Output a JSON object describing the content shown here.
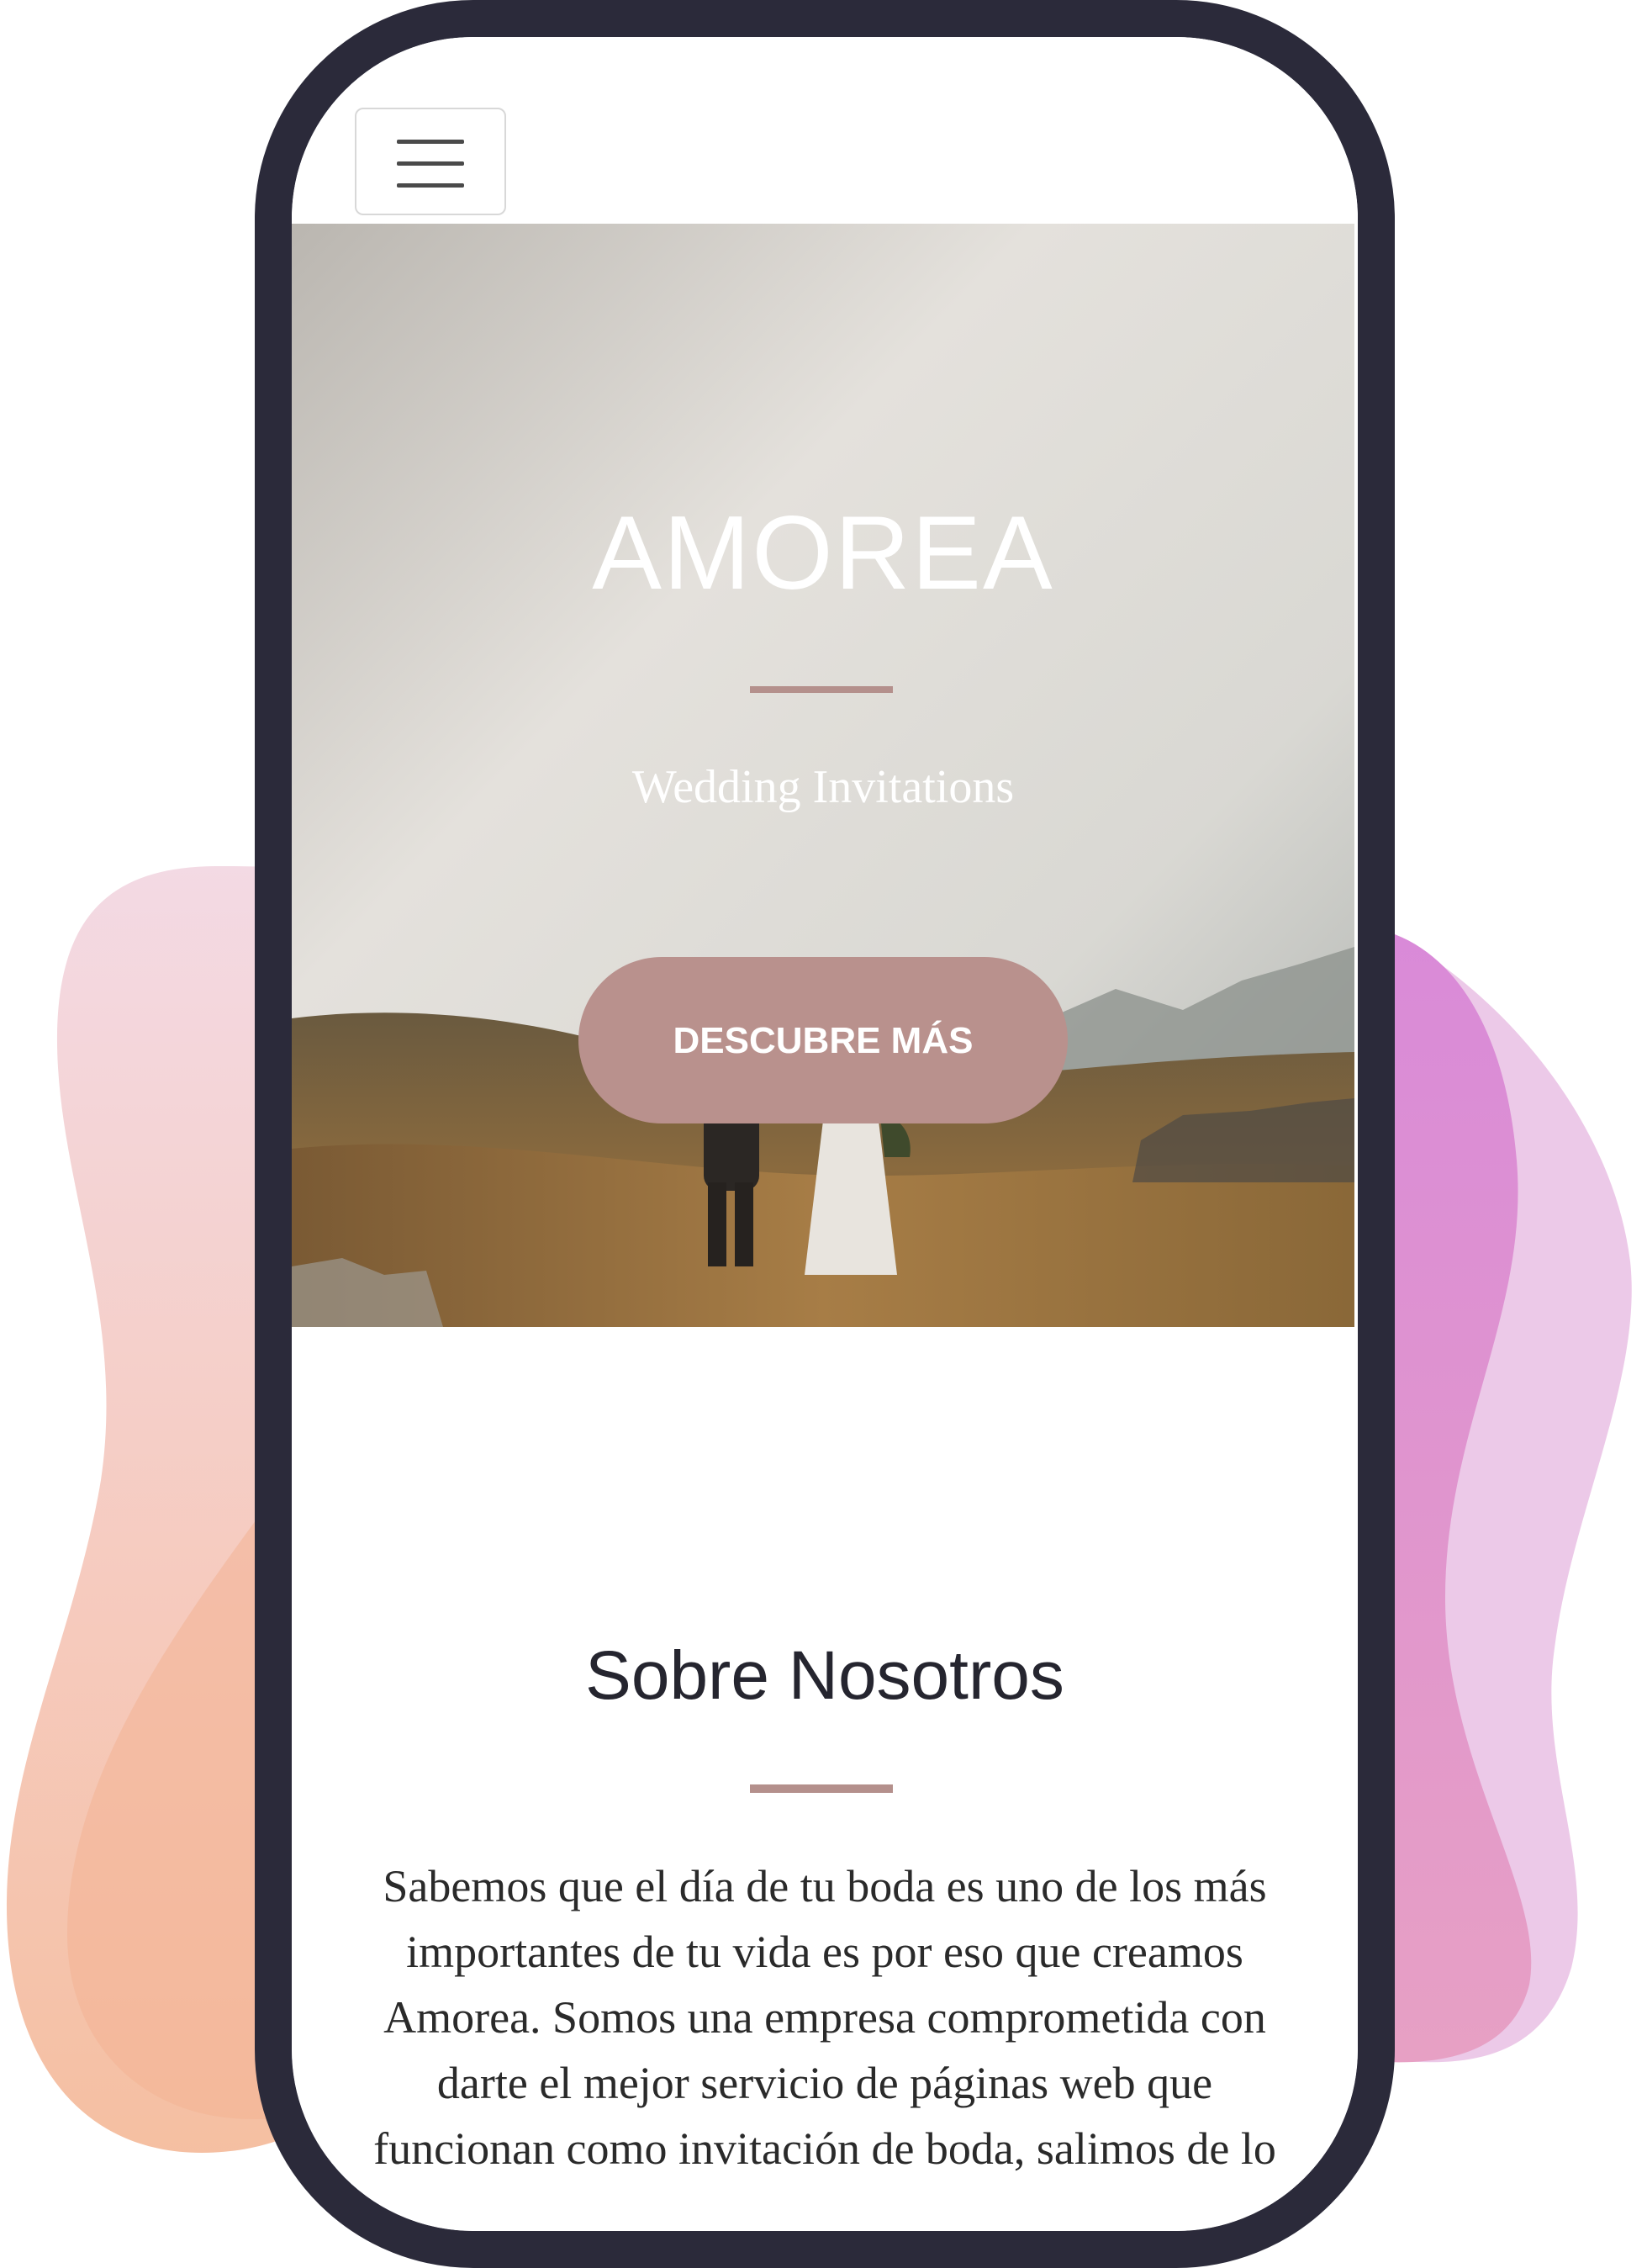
{
  "navbar": {
    "menu_icon": "hamburger-menu-icon"
  },
  "hero": {
    "title": "AMOREA",
    "subtitle": "Wedding Invitations",
    "button_label": "DESCUBRE MÁS",
    "image": "couple-walking-in-mountain-field-photo"
  },
  "about": {
    "title": "Sobre Nosotros",
    "text": "Sabemos que el día de tu boda es uno de los más importantes de tu vida es por eso que creamos Amorea. Somos una empresa comprometida con darte el mejor servicio de páginas web que funcionan como invitación de boda, salimos de lo"
  },
  "colors": {
    "accent": "#b9918d",
    "phone_frame": "#2b2a3a",
    "blob_left": "#f3b9a0",
    "blob_right": "#d98ad8"
  }
}
